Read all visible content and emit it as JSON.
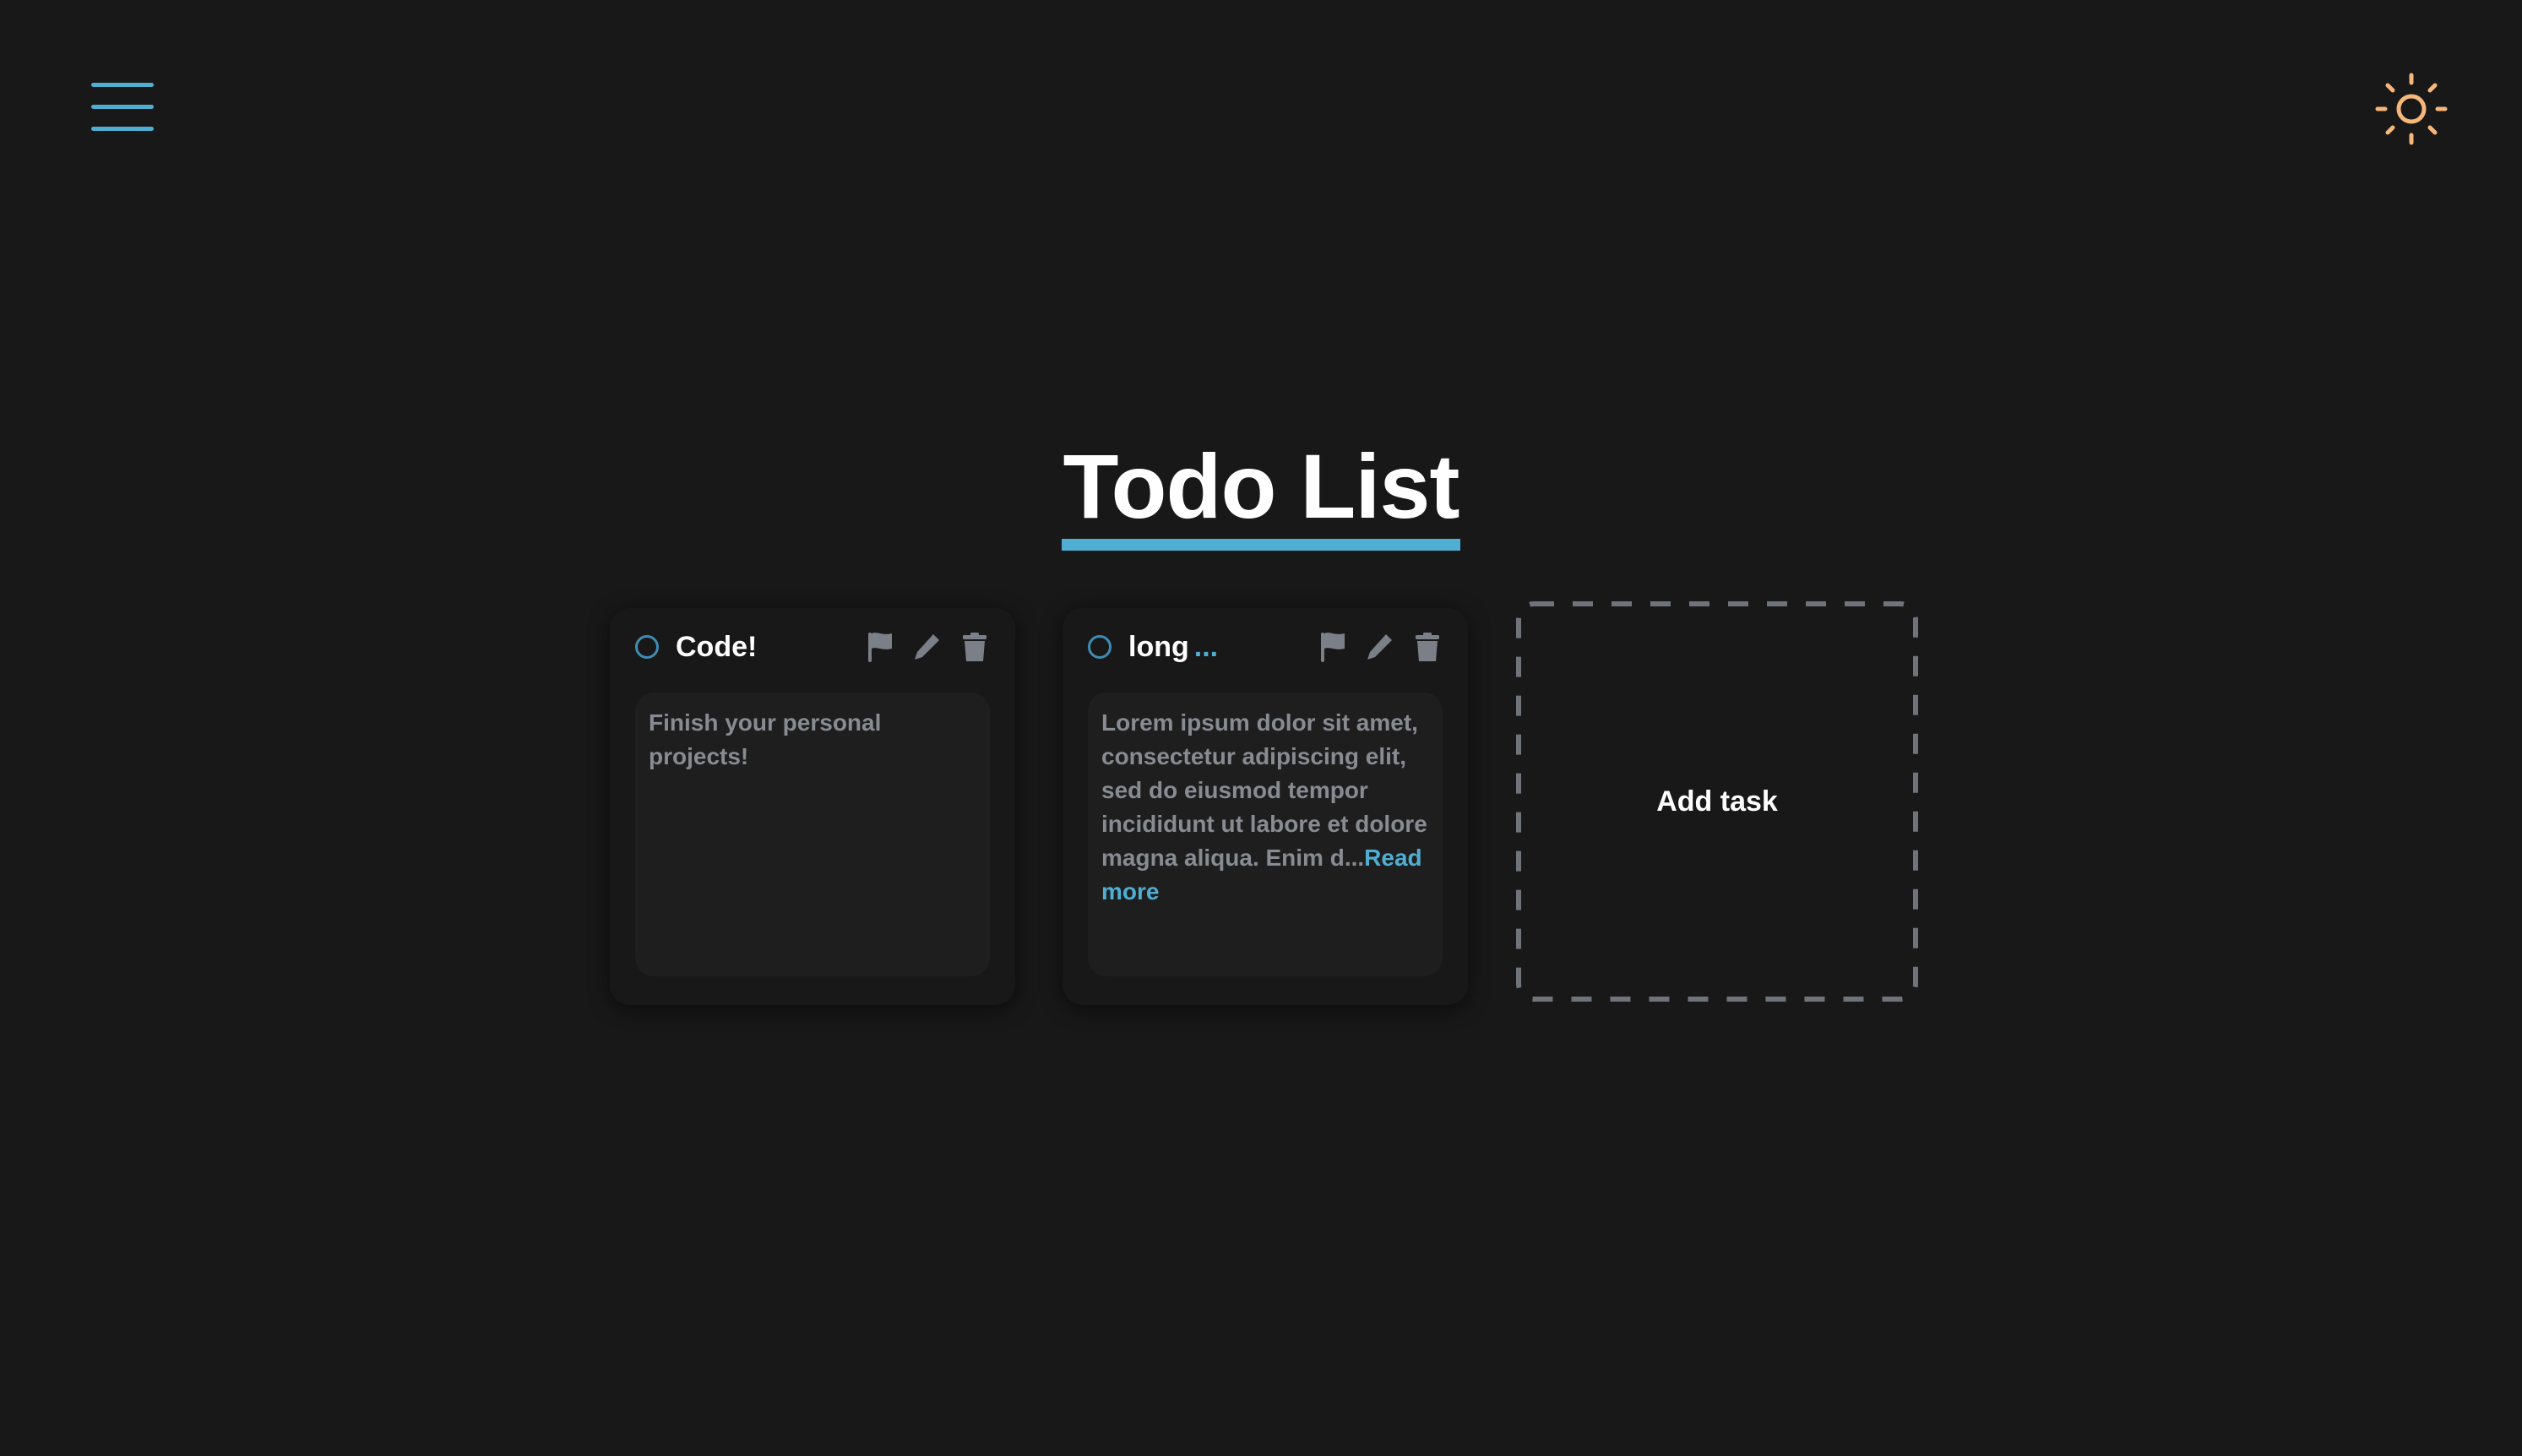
{
  "header": {
    "menu_icon": "hamburger-menu-icon",
    "theme_icon": "sun-icon"
  },
  "page": {
    "title": "Todo List"
  },
  "tasks": [
    {
      "title": "Code!",
      "title_suffix": "",
      "description": "Finish your personal projects!",
      "read_more": ""
    },
    {
      "title": "long",
      "title_suffix": "...",
      "description": "Lorem ipsum dolor sit amet, consectetur adipiscing elit, sed do eiusmod tempor incididunt ut labore et dolore magna aliqua. Enim d...",
      "read_more": "Read more"
    }
  ],
  "task_actions": {
    "flag_icon": "flag-icon",
    "edit_icon": "pencil-icon",
    "delete_icon": "trash-icon"
  },
  "add_task": {
    "label": "Add task"
  },
  "colors": {
    "background": "#181818",
    "accent": "#4faed2",
    "sun": "#f5b77a",
    "muted_text": "#878b92",
    "icon": "#7b7f87",
    "dashed_border": "#6f737a"
  }
}
